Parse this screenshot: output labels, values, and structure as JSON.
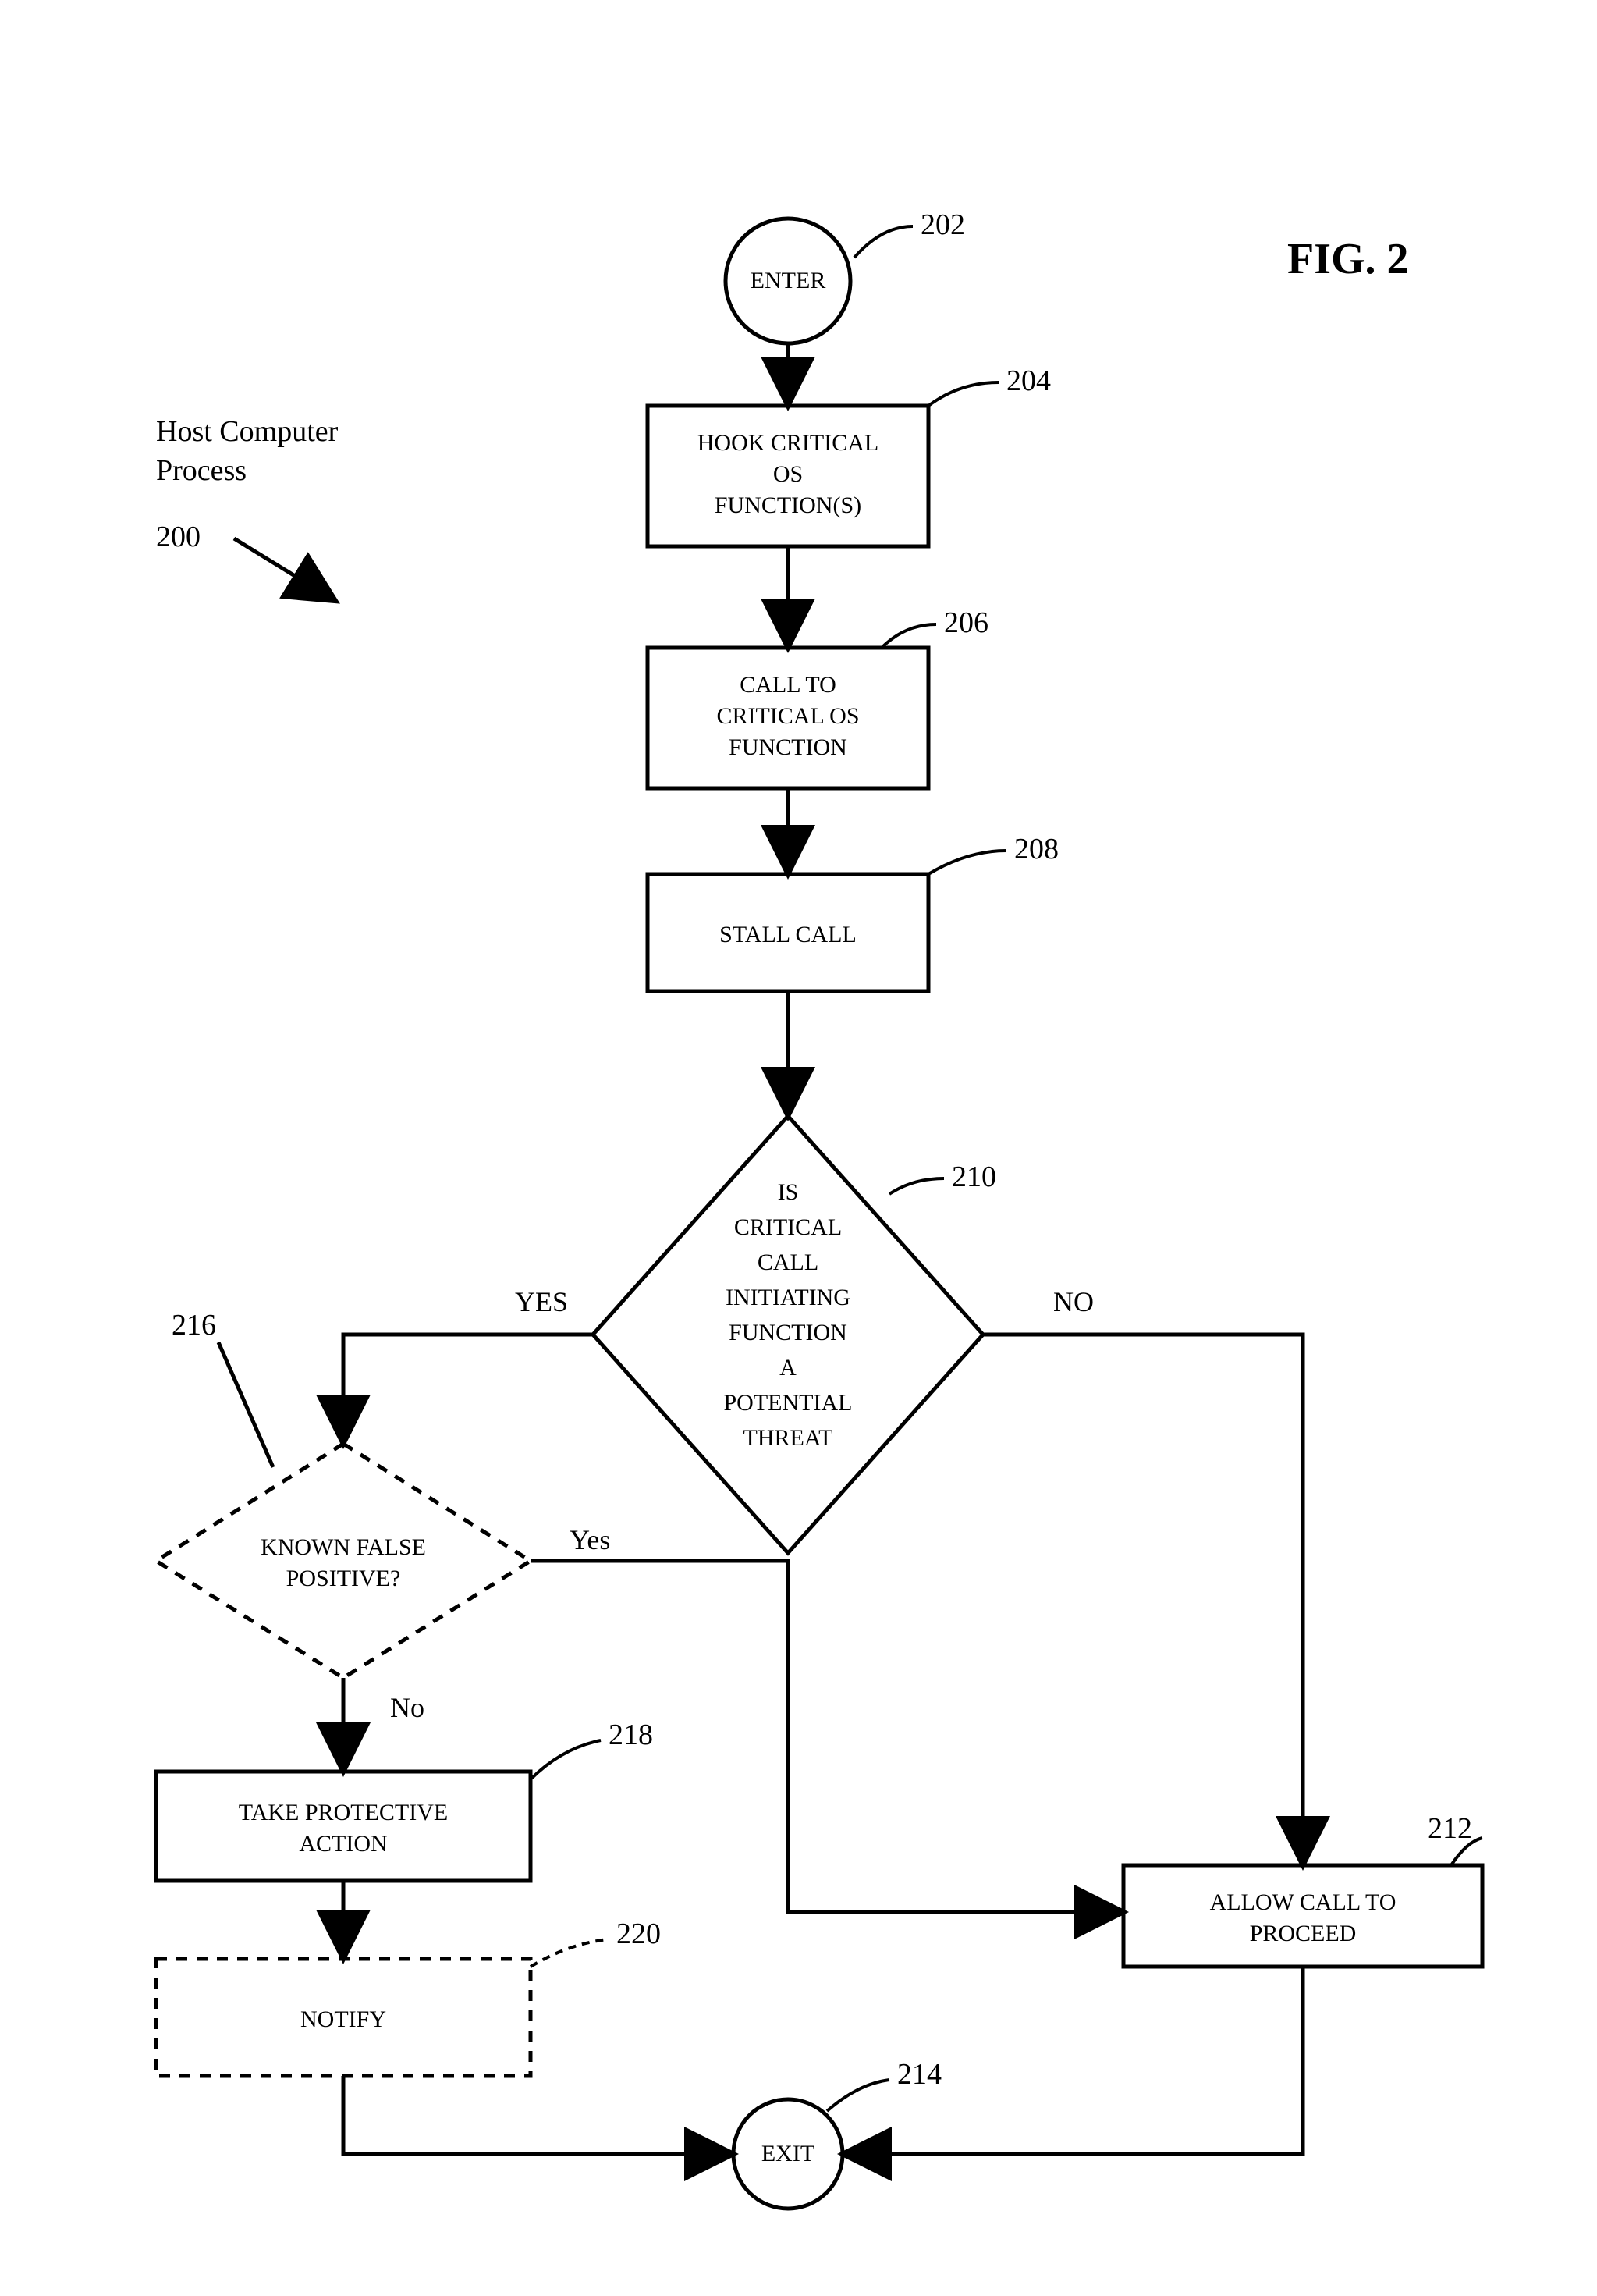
{
  "figure": {
    "title": "FIG. 2",
    "process_label_line1": "Host Computer",
    "process_label_line2": "Process",
    "process_ref": "200"
  },
  "nodes": {
    "enter": {
      "ref": "202",
      "text": "ENTER"
    },
    "hook": {
      "ref": "204",
      "line1": "HOOK CRITICAL",
      "line2": "OS",
      "line3": "FUNCTION(S)"
    },
    "call": {
      "ref": "206",
      "line1": "CALL TO",
      "line2": "CRITICAL OS",
      "line3": "FUNCTION"
    },
    "stall": {
      "ref": "208",
      "text": "STALL CALL"
    },
    "threat": {
      "ref": "210",
      "l1": "IS",
      "l2": "CRITICAL",
      "l3": "CALL",
      "l4": "INITIATING",
      "l5": "FUNCTION",
      "l6": "A",
      "l7": "POTENTIAL",
      "l8": "THREAT"
    },
    "known": {
      "ref": "216",
      "line1": "KNOWN FALSE",
      "line2": "POSITIVE?"
    },
    "protect": {
      "ref": "218",
      "line1": "TAKE PROTECTIVE",
      "line2": "ACTION"
    },
    "notify": {
      "ref": "220",
      "text": "NOTIFY"
    },
    "allow": {
      "ref": "212",
      "line1": "ALLOW CALL TO",
      "line2": "PROCEED"
    },
    "exit": {
      "ref": "214",
      "text": "EXIT"
    }
  },
  "branches": {
    "yes_upper": "YES",
    "no_upper": "NO",
    "yes": "Yes",
    "no": "No"
  }
}
